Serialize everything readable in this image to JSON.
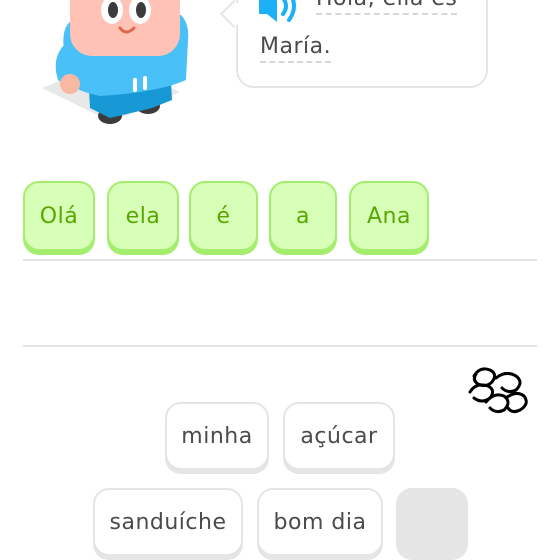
{
  "prompt": {
    "line1": "Hola, ella es",
    "line2": "María."
  },
  "answer_tiles": [
    "Olá",
    "ela",
    "é",
    "a",
    "Ana"
  ],
  "word_bank": [
    "minha",
    "açúcar",
    "sanduíche",
    "bom dia"
  ],
  "colors": {
    "answer_bg": "#d7ffb8",
    "answer_border": "#a5ed6e",
    "answer_text": "#58a700",
    "bank_border": "#e5e5e5",
    "speaker": "#1cb0f6"
  },
  "icons": {
    "speaker": "speaker-icon",
    "scribble": "scribble-icon",
    "character": "character-illustration"
  }
}
